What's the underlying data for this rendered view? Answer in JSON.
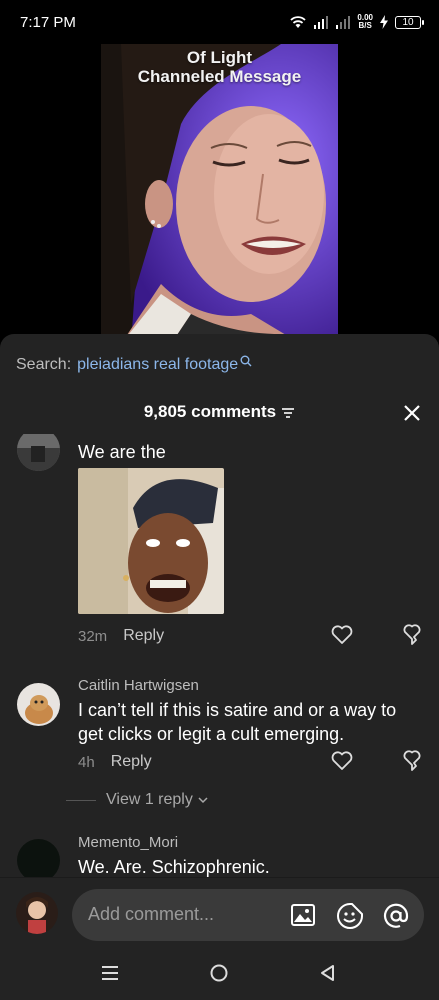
{
  "status_bar": {
    "time": "7:17 PM",
    "net_speed_value": "0.00",
    "net_speed_unit": "B/S",
    "battery": "10"
  },
  "video": {
    "caption_line1": "Of Light",
    "caption_line2": "Channeled Message"
  },
  "search": {
    "label": "Search:",
    "query": "pleiadians real footage"
  },
  "comments_header": {
    "count_label": "9,805 comments"
  },
  "comments": [
    {
      "author": "",
      "text": "We are the",
      "time": "32m",
      "reply_label": "Reply"
    },
    {
      "author": "Caitlin Hartwigsen",
      "text": "I can’t tell if this is satire and or a way to get clicks or legit a cult emerging.",
      "time": "4h",
      "reply_label": "Reply",
      "view_replies": "View 1 reply"
    },
    {
      "author": "Memento_Mori",
      "text": "We. Are. Schizophrenic."
    }
  ],
  "input": {
    "placeholder": "Add comment..."
  },
  "colors": {
    "sheet_bg": "#232323",
    "link_blue": "#8cb7ea",
    "video_purple": "#6b3fe0"
  }
}
